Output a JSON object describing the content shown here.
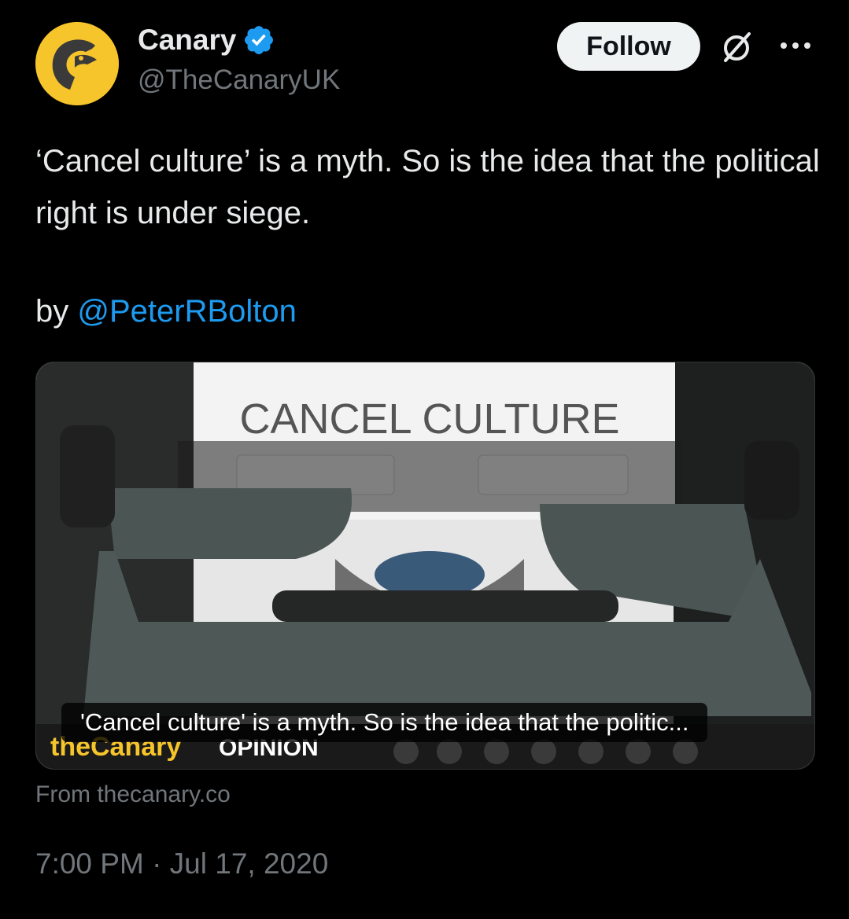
{
  "author": {
    "name": "Canary",
    "handle": "@TheCanaryUK",
    "verified": true,
    "brand_color": "#f6c42b"
  },
  "actions": {
    "follow_label": "Follow",
    "grok_icon": "grok-slash-icon",
    "more_icon": "more-horizontal-icon"
  },
  "tweet": {
    "text": "‘Cancel culture’ is a myth. So is the idea that the political right is under siege.",
    "by_prefix": "by ",
    "mention": "@PeterRBolton"
  },
  "card": {
    "image_text": "CANCEL CULTURE",
    "logo_text": "theCanary",
    "tag_text": "OPINION",
    "caption": "'Cancel culture' is a myth. So is the idea that the politic...",
    "source": "From thecanary.co"
  },
  "timestamp": "7:00 PM · Jul 17, 2020",
  "colors": {
    "background": "#000000",
    "text": "#e7e9ea",
    "muted": "#71767b",
    "link": "#1d9bf0",
    "verified": "#1d9bf0"
  }
}
